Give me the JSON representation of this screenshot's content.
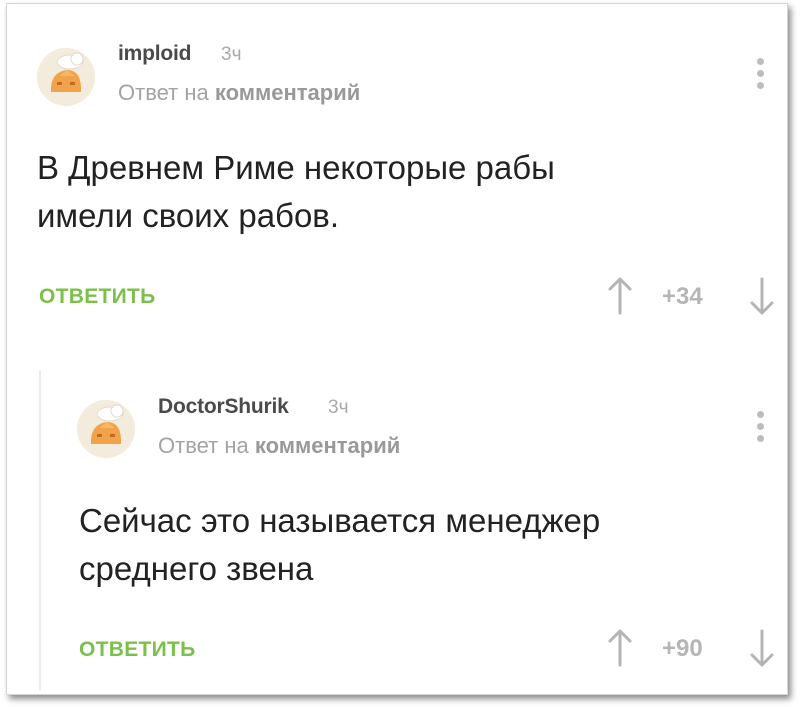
{
  "comments": [
    {
      "username": "imploid",
      "time": "3ч",
      "reply_prefix": "Ответ на",
      "reply_target": "комментарий",
      "text_line1": "В Древнем Риме некоторые рабы",
      "text_line2": "имели своих рабов.",
      "reply_label": "ОТВЕТИТЬ",
      "rating": "+34"
    },
    {
      "username": "DoctorShurik",
      "time": "3ч",
      "reply_prefix": "Ответ на",
      "reply_target": "комментарий",
      "text_line1": "Сейчас это называется менеджер",
      "text_line2": "среднего звена",
      "reply_label": "ОТВЕТИТЬ",
      "rating": "+90"
    }
  ],
  "colors": {
    "reply_green": "#7cc04b",
    "text": "#222222",
    "muted": "#a3a3a3",
    "arrow": "#b5b5b5"
  }
}
